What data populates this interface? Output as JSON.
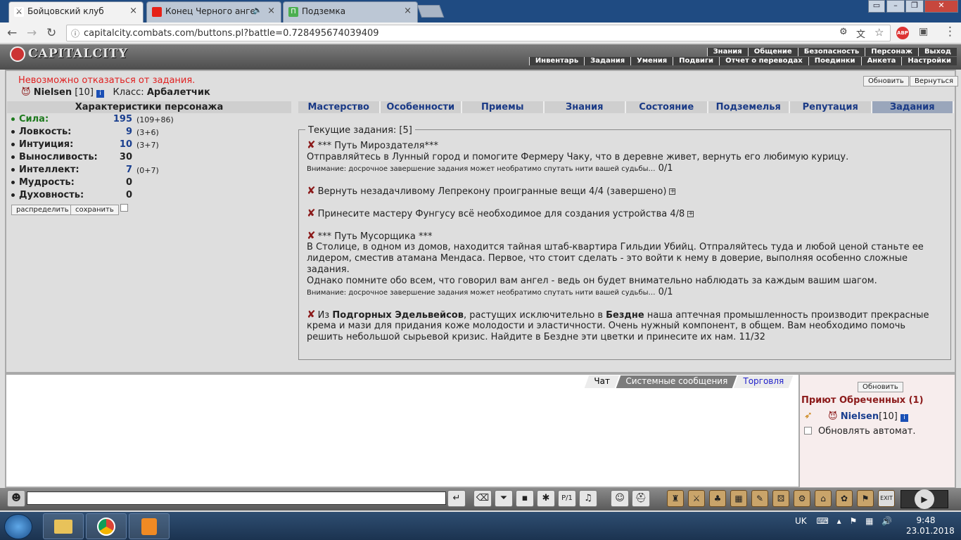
{
  "browser": {
    "tabs": [
      {
        "title": "Бойцовский клуб",
        "active": true
      },
      {
        "title": "Конец Черного анге",
        "active": false
      },
      {
        "title": "Подземка",
        "active": false
      }
    ],
    "url": "capitalcity.combats.com/buttons.pl?battle=0.728495674039409"
  },
  "game": {
    "logo": "CAPITALCITY",
    "top_menu": [
      "Знания",
      "Общение",
      "Безопасность",
      "Персонаж",
      "Выход"
    ],
    "sub_menu": [
      "Инвентарь",
      "Задания",
      "Умения",
      "Подвиги",
      "Отчет о переводах",
      "Поединки",
      "Анкета",
      "Настройки"
    ],
    "error": "Невозможно отказаться от задания.",
    "refresh_label": "Обновить",
    "back_label": "Вернуться",
    "player": {
      "name": "Nielsen",
      "level": "[10]",
      "class_label": "Класс:",
      "class": "Арбалетчик"
    },
    "stats": {
      "title": "Характеристики персонажа",
      "items": [
        {
          "label": "Сила:",
          "value": "195",
          "bonus": "(109+86)"
        },
        {
          "label": "Ловкость:",
          "value": "9",
          "bonus": "(3+6)"
        },
        {
          "label": "Интуиция:",
          "value": "10",
          "bonus": "(3+7)"
        },
        {
          "label": "Выносливость:",
          "value": "30",
          "bonus": ""
        },
        {
          "label": "Интеллект:",
          "value": "7",
          "bonus": "(0+7)"
        },
        {
          "label": "Мудрость:",
          "value": "0",
          "bonus": ""
        },
        {
          "label": "Духовность:",
          "value": "0",
          "bonus": ""
        }
      ],
      "distribute": "распределить",
      "save": "сохранить"
    },
    "tabs": [
      "Мастерство",
      "Особенности",
      "Приемы",
      "Знания",
      "Состояние",
      "Подземелья",
      "Репутация",
      "Задания"
    ],
    "quests": {
      "legend": "Текущие задания: [5]",
      "q1_title": "*** Путь Мироздателя***",
      "q1_text": "Отправляйтесь в Лунный город и помогите Фермеру Чаку, что в деревне живет, вернуть его любимую курицу.",
      "q1_warn": "Внимание: досрочное завершение задания может необратимо спутать нити вашей судьбы…",
      "q1_progress": "0/1",
      "q2": "Вернуть незадачливому Лепрекону проигранные вещи 4/4 (завершено)",
      "q3": "Принесите мастеру Фунгусу всё необходимое для создания устройства 4/8",
      "q4_title": "*** Путь Мусорщика ***",
      "q4_l1": "В Столице, в одном из домов, находится тайная штаб-квартира Гильдии Убийц. Отпраляйтесь туда и любой ценой станьте ее",
      "q4_l2": "лидером, сместив атамана Мендаса. Первое, что стоит сделать - это войти к нему в доверие, выполняя особенно сложные",
      "q4_l3": "задания.",
      "q4_l4": "Однако помните обо всем, что говорил вам ангел - ведь он будет внимательно наблюдать за каждым вашим шагом.",
      "q4_warn": "Внимание: досрочное завершение задания может необратимо спутать нити вашей судьбы…",
      "q4_progress": "0/1",
      "q5_a": "Из ",
      "q5_b": "Подгорных Эдельвейсов",
      "q5_c": ", растущих исключительно в ",
      "q5_d": "Бездне",
      "q5_e": " наша аптечная промышленность производит прекрасные",
      "q5_l2": "крема и мази для придания коже молодости и эластичности. Очень нужный компонент, в общем. Вам необходимо помочь",
      "q5_l3": "решить небольшой сырьевой кризис. Найдите в Бездне эти цветки и принесите их нам. 11/32"
    },
    "chat_tabs": [
      "Чат",
      "Системные сообщения",
      "Торговля"
    ],
    "room": {
      "refresh": "Обновить",
      "name": "Приют Обреченных (1)",
      "player": "Nielsen",
      "level": "[10]",
      "auto": "Обновлять автомат."
    }
  },
  "taskbar": {
    "lang": "UK",
    "time": "9:48",
    "date": "23.01.2018"
  }
}
